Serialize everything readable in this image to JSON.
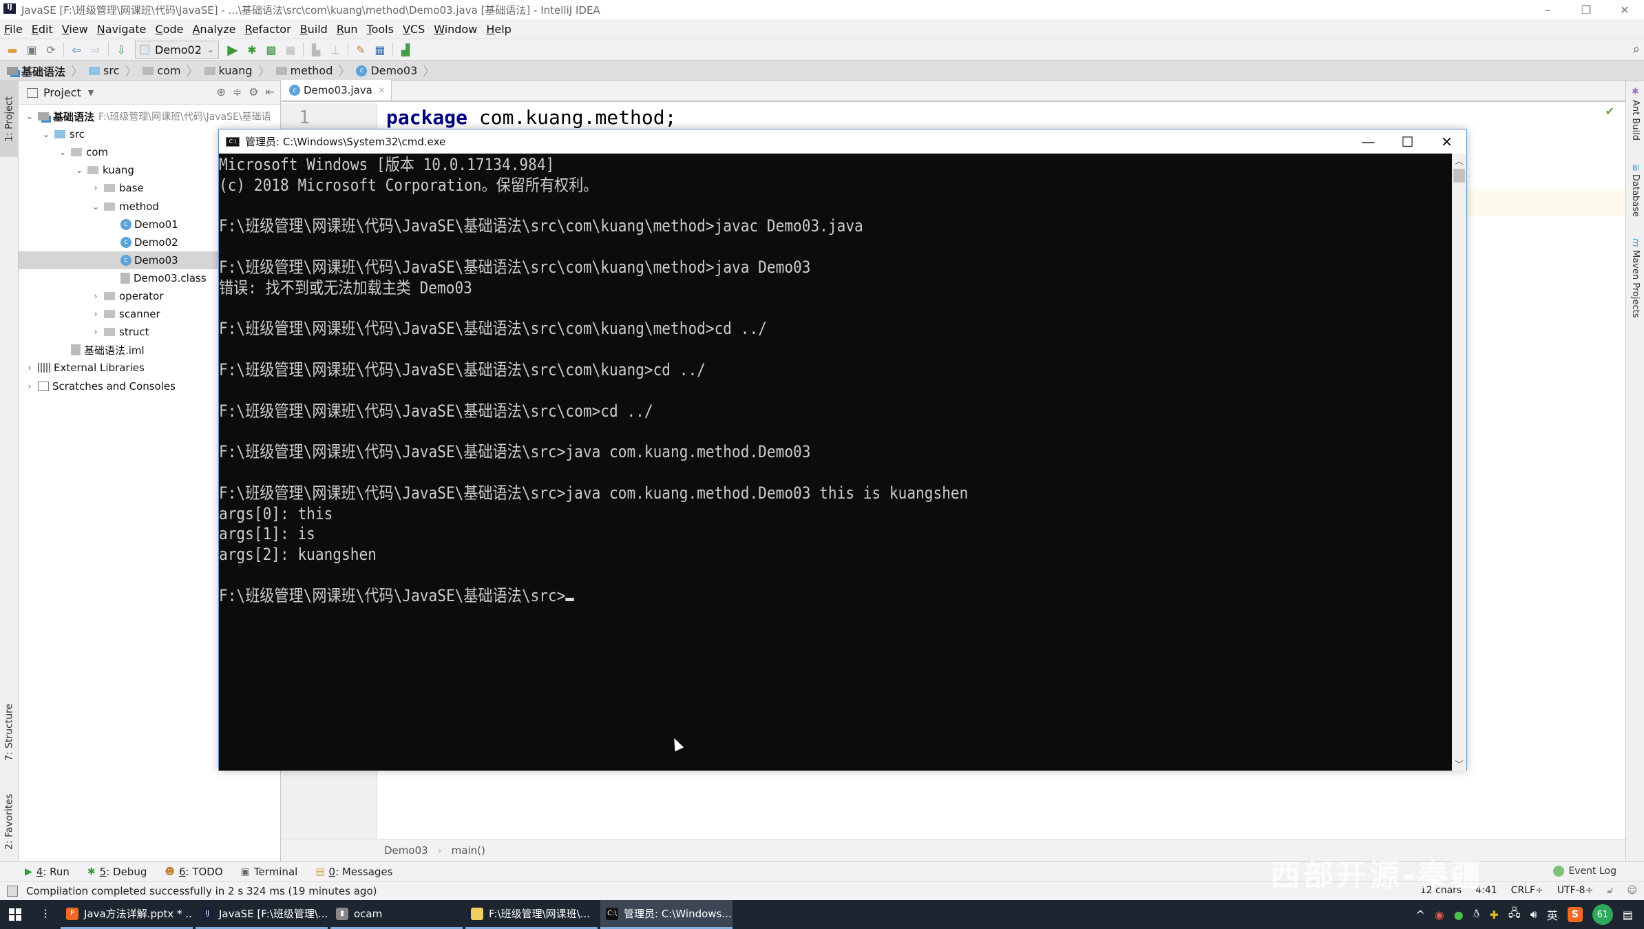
{
  "window": {
    "title": "JavaSE [F:\\班级管理\\网课班\\代码\\JavaSE] - ...\\基础语法\\src\\com\\kuang\\method\\Demo03.java [基础语法] - IntelliJ IDEA",
    "app_icon": "IJ",
    "minimize": "–",
    "restore": "❐",
    "close": "✕"
  },
  "menu": [
    "File",
    "Edit",
    "View",
    "Navigate",
    "Code",
    "Analyze",
    "Refactor",
    "Build",
    "Run",
    "Tools",
    "VCS",
    "Window",
    "Help"
  ],
  "toolbar": {
    "run_config": "Demo02",
    "icons": [
      "open-folder-icon",
      "save-icon",
      "sync-icon",
      "back-icon",
      "forward-icon",
      "build-icon",
      "run-icon",
      "debug-icon",
      "coverage-icon",
      "stop-icon",
      "attach-icon",
      "profile-icon",
      "project-structure-icon",
      "sdk-icon",
      "sdk-manager-icon",
      "search-icon"
    ]
  },
  "nav_breadcrumbs": [
    {
      "label": "基础语法",
      "icon": "module"
    },
    {
      "label": "src",
      "icon": "source-folder"
    },
    {
      "label": "com",
      "icon": "folder"
    },
    {
      "label": "kuang",
      "icon": "folder"
    },
    {
      "label": "method",
      "icon": "folder"
    },
    {
      "label": "Demo03",
      "icon": "class"
    }
  ],
  "left_tabs": {
    "project": "1: Project",
    "structure": "7: Structure",
    "favorites": "2: Favorites"
  },
  "right_tabs": {
    "ant": "Ant Build",
    "database": "Database",
    "maven": "Maven Projects"
  },
  "project_panel": {
    "title": "Project",
    "tree": [
      {
        "label": "基础语法",
        "hint": "F:\\班级管理\\网课班\\代码\\JavaSE\\基础语",
        "icon": "module",
        "depth": 0,
        "arrow": "expanded",
        "bold": true
      },
      {
        "label": "src",
        "icon": "source-folder",
        "depth": 1,
        "arrow": "expanded"
      },
      {
        "label": "com",
        "icon": "folder",
        "depth": 2,
        "arrow": "expanded"
      },
      {
        "label": "kuang",
        "icon": "folder",
        "depth": 3,
        "arrow": "expanded"
      },
      {
        "label": "base",
        "icon": "folder",
        "depth": 4,
        "arrow": "collapsed"
      },
      {
        "label": "method",
        "icon": "folder",
        "depth": 4,
        "arrow": "expanded"
      },
      {
        "label": "Demo01",
        "icon": "class",
        "depth": 5,
        "arrow": "none"
      },
      {
        "label": "Demo02",
        "icon": "class",
        "depth": 5,
        "arrow": "none"
      },
      {
        "label": "Demo03",
        "icon": "class",
        "depth": 5,
        "arrow": "none",
        "selected": true
      },
      {
        "label": "Demo03.class",
        "icon": "class-file",
        "depth": 5,
        "arrow": "none"
      },
      {
        "label": "operator",
        "icon": "folder",
        "depth": 4,
        "arrow": "collapsed"
      },
      {
        "label": "scanner",
        "icon": "folder",
        "depth": 4,
        "arrow": "collapsed"
      },
      {
        "label": "struct",
        "icon": "folder",
        "depth": 4,
        "arrow": "collapsed"
      },
      {
        "label": "基础语法.iml",
        "icon": "iml-file",
        "depth": 2,
        "arrow": "none"
      },
      {
        "label": "External Libraries",
        "icon": "library",
        "depth": 0,
        "arrow": "collapsed"
      },
      {
        "label": "Scratches and Consoles",
        "icon": "scratch",
        "depth": 0,
        "arrow": "collapsed"
      }
    ]
  },
  "editor": {
    "tab": "Demo03.java",
    "line_number": "1",
    "code_keyword": "package",
    "code_rest": " com.kuang.method;",
    "breadcrumb": [
      "Demo03",
      "main()"
    ]
  },
  "cmd": {
    "title": "管理员: C:\\Windows\\System32\\cmd.exe",
    "lines": [
      "Microsoft Windows [版本 10.0.17134.984]",
      "(c) 2018 Microsoft Corporation。保留所有权利。",
      "",
      "F:\\班级管理\\网课班\\代码\\JavaSE\\基础语法\\src\\com\\kuang\\method>javac Demo03.java",
      "",
      "F:\\班级管理\\网课班\\代码\\JavaSE\\基础语法\\src\\com\\kuang\\method>java Demo03",
      "错误: 找不到或无法加载主类 Demo03",
      "",
      "F:\\班级管理\\网课班\\代码\\JavaSE\\基础语法\\src\\com\\kuang\\method>cd ../",
      "",
      "F:\\班级管理\\网课班\\代码\\JavaSE\\基础语法\\src\\com\\kuang>cd ../",
      "",
      "F:\\班级管理\\网课班\\代码\\JavaSE\\基础语法\\src\\com>cd ../",
      "",
      "F:\\班级管理\\网课班\\代码\\JavaSE\\基础语法\\src>java com.kuang.method.Demo03",
      "",
      "F:\\班级管理\\网课班\\代码\\JavaSE\\基础语法\\src>java com.kuang.method.Demo03 this is kuangshen",
      "args[0]: this",
      "args[1]: is",
      "args[2]: kuangshen",
      "",
      "F:\\班级管理\\网课班\\代码\\JavaSE\\基础语法\\src>"
    ]
  },
  "tool_windows": [
    {
      "key": "4",
      "label": ": Run",
      "icon": "run-icon"
    },
    {
      "key": "5",
      "label": ": Debug",
      "icon": "debug-icon"
    },
    {
      "key": "6",
      "label": ": TODO",
      "icon": "todo-icon"
    },
    {
      "key": "",
      "label": "Terminal",
      "icon": "terminal-icon"
    },
    {
      "key": "0",
      "label": ": Messages",
      "icon": "messages-icon"
    }
  ],
  "event_log": "Event Log",
  "status": {
    "message": "Compilation completed successfully in 2 s 324 ms (19 minutes ago)",
    "chars": "12 chars",
    "position": "4:41",
    "line_sep": "CRLF÷",
    "encoding": "UTF-8÷"
  },
  "watermark": "西部开源-秦疆",
  "taskbar": {
    "tasks": [
      {
        "label": "Java方法详解.pptx * ...",
        "color": "#f06a26",
        "glyph": "P"
      },
      {
        "label": "JavaSE [F:\\班级管理\\...",
        "color": "#1b1f3b",
        "glyph": "IJ"
      },
      {
        "label": "ocam",
        "color": "#888888",
        "glyph": "▮"
      },
      {
        "label": "F:\\班级管理\\网课班\\...",
        "color": "#f2cf63",
        "glyph": ""
      },
      {
        "label": "管理员: C:\\Windows...",
        "color": "#111111",
        "glyph": "C:\\",
        "active": true
      }
    ],
    "tray": {
      "ime": "英",
      "badge": "61",
      "chevron": "^"
    }
  }
}
